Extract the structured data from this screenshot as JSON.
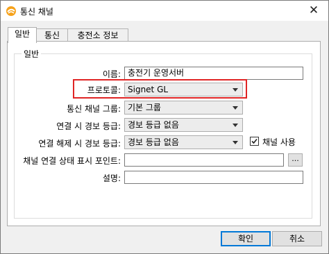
{
  "window": {
    "title": "통신 채널",
    "close_glyph": "✕"
  },
  "tabs": [
    {
      "label": "일반",
      "active": true
    },
    {
      "label": "통신",
      "active": false
    },
    {
      "label": "충전소 정보",
      "active": false
    }
  ],
  "group": {
    "title": "일반"
  },
  "fields": {
    "name_label": "이름:",
    "name_value": "충전기 운영서버",
    "protocol_label": "프로토콜:",
    "protocol_value": "Signet GL",
    "channel_group_label": "통신 채널 그룹:",
    "channel_group_value": "기본 그룹",
    "connect_alarm_label": "연결 시 경보 등급:",
    "connect_alarm_value": "경보 등급 없음",
    "disconnect_alarm_label": "연결 해제 시 경보 등급:",
    "disconnect_alarm_value": "경보 등급 없음",
    "use_channel_label": "채널 사용",
    "use_channel_checked": true,
    "status_point_label": "채널 연결 상태 표시 포인트:",
    "status_point_value": "",
    "browse_label": "...",
    "description_label": "설명:",
    "description_value": ""
  },
  "buttons": {
    "ok": "확인",
    "cancel": "취소"
  },
  "colors": {
    "highlight_border": "#e02424",
    "default_button_border": "#0078d7"
  }
}
